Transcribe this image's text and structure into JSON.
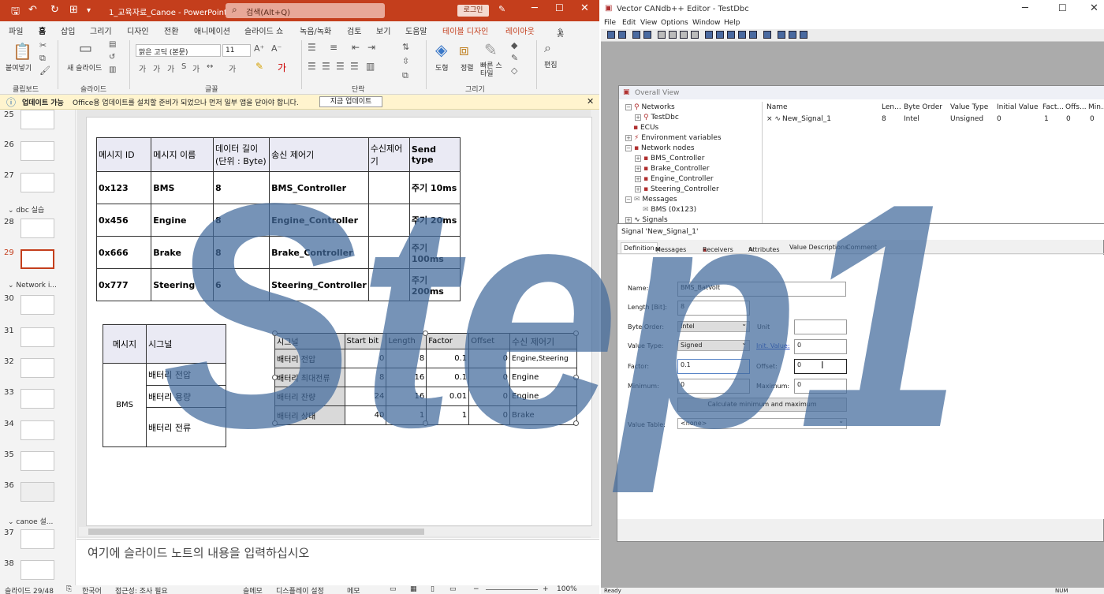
{
  "ppt": {
    "title": "1_교육자료_Canoe  -  PowerPoint",
    "search_placeholder": "검색(Alt+Q)",
    "login": "로그인",
    "tabs": [
      "파일",
      "홈",
      "삽입",
      "그리기",
      "디자인",
      "전환",
      "애니메이션",
      "슬라이드 쇼",
      "녹음/녹화",
      "검토",
      "보기",
      "도움말",
      "테이블 디자인",
      "레이아웃"
    ],
    "share": "공유",
    "ribbon": {
      "paste": "붙여넣기",
      "new_slide": "새 슬라이드",
      "font_name": "맑은 고딕 (본문)",
      "font_size": "11",
      "shape": "도형",
      "arrange": "정렬",
      "quick_style": "빠른 스타일",
      "edit": "편집",
      "groups": [
        "클립보드",
        "슬라이드",
        "글꼴",
        "단락",
        "그리기"
      ]
    },
    "update_bar": {
      "title": "업데이트 가능",
      "message": "Office용 업데이트를 설치할 준비가 되었으나 먼저 일부 앱을 닫아야 합니다.",
      "button": "지금 업데이트"
    },
    "thumbs": [
      "25",
      "26",
      "27",
      "28",
      "29",
      "30",
      "31",
      "32",
      "33",
      "34",
      "35",
      "36",
      "37",
      "38"
    ],
    "sections": [
      "dbc 실습",
      "Network i...",
      "canoe 설..."
    ],
    "slide": {
      "table1": {
        "headers": [
          "메시지 ID",
          "메시지 이름",
          "데이터 길이 (단위 : Byte)",
          "송신 제어기",
          "수신제어기",
          "Send type"
        ],
        "rows": [
          [
            "0x123",
            "BMS",
            "8",
            "BMS_Controller",
            "",
            "주기 10ms"
          ],
          [
            "0x456",
            "Engine",
            "8",
            "Engine_Controller",
            "",
            "주기 20ms"
          ],
          [
            "0x666",
            "Brake",
            "8",
            "Brake_Controller",
            "",
            "주기 100ms"
          ],
          [
            "0x777",
            "Steering",
            "6",
            "Steering_Controller",
            "",
            "주기 200ms"
          ]
        ]
      },
      "table2": {
        "headers": [
          "메시지",
          "시그널"
        ],
        "message": "BMS",
        "signals": [
          "배터리 전압",
          "배터리 용량",
          "배터리 전류"
        ]
      },
      "table3": {
        "headers": [
          "시그널",
          "Start bit",
          "Length",
          "Factor",
          "Offset",
          "수신 제어기"
        ],
        "rows": [
          [
            "배터리 전압",
            "0",
            "8",
            "0.1",
            "0",
            "Engine,Steering"
          ],
          [
            "배터리 최대전류",
            "8",
            "16",
            "0.1",
            "0",
            "Engine"
          ],
          [
            "배터리 잔량",
            "24",
            "16",
            "0.01",
            "0",
            "Engine"
          ],
          [
            "배터리 상태",
            "40",
            "1",
            "1",
            "0",
            "Brake"
          ]
        ]
      }
    },
    "notes_placeholder": "여기에 슬라이드 노트의 내용을 입력하십시오",
    "status": {
      "slide": "슬라이드 29/48",
      "lang": "한국어",
      "access": "접근성: 조사 필요",
      "notes": "슬메모",
      "display": "디스플레이 설정",
      "memo": "메모",
      "zoom": "100%"
    }
  },
  "overlay_text": "Step1",
  "can": {
    "title": "Vector CANdb++ Editor - TestDbc",
    "menu": [
      "File",
      "Edit",
      "View",
      "Options",
      "Window",
      "Help"
    ],
    "overall_title": "Overall View",
    "tree": [
      "Networks",
      "TestDbc",
      "ECUs",
      "Environment variables",
      "Network nodes",
      "BMS_Controller",
      "Brake_Controller",
      "Engine_Controller",
      "Steering_Controller",
      "Messages",
      "BMS (0x123)",
      "Signals"
    ],
    "list_headers": [
      "Name",
      "Len...",
      "Byte Order",
      "Value Type",
      "Initial Value",
      "Fact...",
      "Offs...",
      "Min..."
    ],
    "list_row": [
      "New_Signal_1",
      "8",
      "Intel",
      "Unsigned",
      "0",
      "1",
      "0",
      "0"
    ],
    "signal_dialog": {
      "title": "Signal 'New_Signal_1'",
      "tabs": [
        "Definition",
        "Messages",
        "Receivers",
        "Attributes",
        "Value Descriptions",
        "Comment"
      ],
      "name_label": "Name:",
      "name_value": "BMS_BatVolt",
      "length_label": "Length [Bit]:",
      "length_value": "8",
      "byte_order_label": "Byte Order:",
      "byte_order_value": "Intel",
      "unit_label": "Unit",
      "value_type_label": "Value Type:",
      "value_type_value": "Signed",
      "init_label": "Init. Value:",
      "init_value": "0",
      "factor_label": "Factor:",
      "factor_value": "0.1",
      "offset_label": "Offset:",
      "offset_value": "0",
      "min_label": "Minimum:",
      "min_value": "0",
      "max_label": "Maximum:",
      "max_value": "0",
      "calc_button": "Calculate minimum and maximum",
      "value_table_label": "Value Table:",
      "value_table_value": "<none>"
    },
    "status_left": "Ready",
    "status_right": "NUM"
  }
}
